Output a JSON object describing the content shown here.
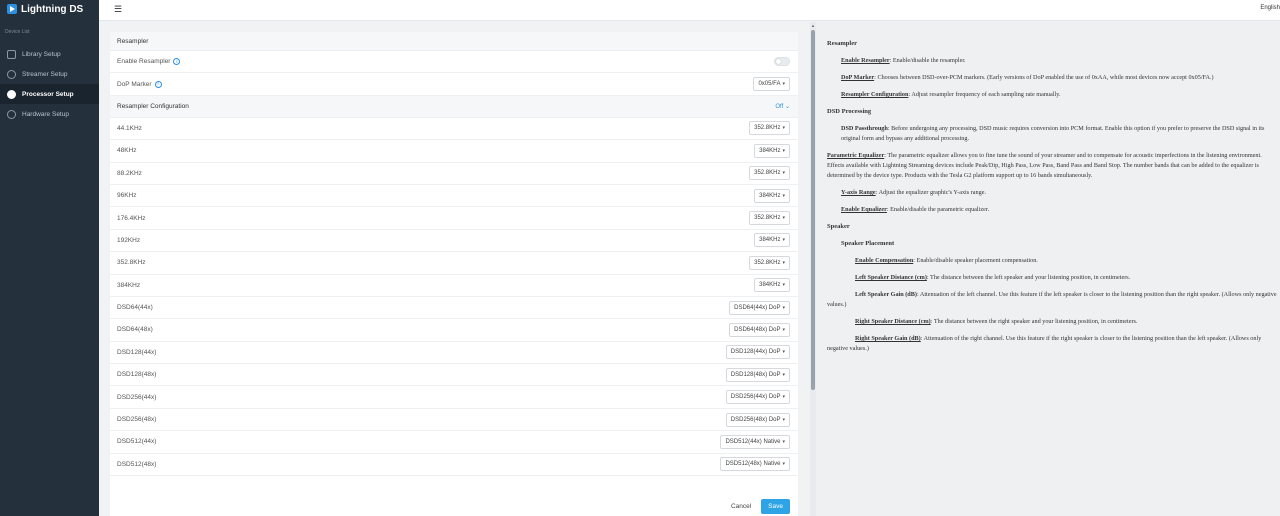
{
  "app": {
    "title": "Lightning DS",
    "device_list": "Device List",
    "language": "English"
  },
  "sidebar": {
    "items": [
      {
        "label": "Library Setup",
        "icon": "library-icon",
        "active": false
      },
      {
        "label": "Streamer Setup",
        "icon": "play-icon",
        "active": false
      },
      {
        "label": "Processor Setup",
        "icon": "processor-icon",
        "active": true
      },
      {
        "label": "Hardware Setup",
        "icon": "gear-icon",
        "active": false
      }
    ]
  },
  "resampler": {
    "section_title": "Resampler",
    "enable_label": "Enable Resampler",
    "enable_on": false,
    "dop_label": "DoP Marker",
    "dop_value": "0x05/FA",
    "config_title": "Resampler Configuration",
    "config_state": "Off",
    "rows": [
      {
        "label": "44.1KHz",
        "value": "352.8KHz"
      },
      {
        "label": "48KHz",
        "value": "384KHz"
      },
      {
        "label": "88.2KHz",
        "value": "352.8KHz"
      },
      {
        "label": "96KHz",
        "value": "384KHz"
      },
      {
        "label": "176.4KHz",
        "value": "352.8KHz"
      },
      {
        "label": "192KHz",
        "value": "384KHz"
      },
      {
        "label": "352.8KHz",
        "value": "352.8KHz"
      },
      {
        "label": "384KHz",
        "value": "384KHz"
      },
      {
        "label": "DSD64(44x)",
        "value": "DSD64(44x) DoP"
      },
      {
        "label": "DSD64(48x)",
        "value": "DSD64(48x) DoP"
      },
      {
        "label": "DSD128(44x)",
        "value": "DSD128(44x) DoP"
      },
      {
        "label": "DSD128(48x)",
        "value": "DSD128(48x) DoP"
      },
      {
        "label": "DSD256(44x)",
        "value": "DSD256(44x) DoP"
      },
      {
        "label": "DSD256(48x)",
        "value": "DSD256(48x) DoP"
      },
      {
        "label": "DSD512(44x)",
        "value": "DSD512(44x) Native"
      },
      {
        "label": "DSD512(48x)",
        "value": "DSD512(48x) Native"
      }
    ],
    "cancel_label": "Cancel",
    "save_label": "Save"
  },
  "help": {
    "resampler_title": "Resampler",
    "enable_resampler_term": "Enable Resampler",
    "enable_resampler_text": ": Enable/disable the resampler.",
    "dop_marker_term": "DoP Marker",
    "dop_marker_text": ": Chooses between DSD-over-PCM markers. (Early versions of DoP enabled the use of 0xAA, while most devices now accept 0x05/FA.)",
    "resampler_config_term": "Resampler Configuration",
    "resampler_config_text": ": Adjust resampler frequency of each sampling rate manually.",
    "dsd_processing_title": "DSD Processing",
    "dsd_passthrough_term": "DSD Passthrough",
    "dsd_passthrough_text": ": Before undergoing any processing, DSD music requires conversion into PCM format. Enable this option if you prefer to preserve the DSD signal in its original form and bypass any additional processing.",
    "peq_term": "Parametric Equalizer",
    "peq_text": ": The parametric equalizer allows you to fine tune the sound of your streamer and to compensate for acoustic imperfections in the listening environment. Effects available with Lightning Streaming devices include Peak/Dip, High Pass, Low Pass, Band Pass and Band Stop. The number bands that can be added to the equalizer is determined by the device type. Products with the Tesla G2 platform support up to 16 bands simultaneously.",
    "yaxis_term": "Y-axis Range",
    "yaxis_text": ": Adjust the equalizer graphic's Y-axis range.",
    "enable_eq_term": "Enable Equalizer",
    "enable_eq_text": ": Enable/disable the parametric equalizer.",
    "speaker_title": "Speaker",
    "speaker_placement_title": "Speaker Placement",
    "enable_comp_term": "Enable Compensation",
    "enable_comp_text": ": Enable/disable speaker placement compensation.",
    "left_dist_term": "Left Speaker Distance (cm)",
    "left_dist_text": ": The distance between the left speaker and your listening position, in centimeters.",
    "left_gain_term": "Left Speaker Gain (dB)",
    "left_gain_text": ": Attenuation of the left channel. Use this feature if the left speaker is closer to the listening position than the right speaker. (Allows only negative values.)",
    "right_dist_term": "Right Speaker Distance (cm)",
    "right_dist_text": ": The distance between the right speaker and your listening position, in centimeters.",
    "right_gain_term": "Right Speaker Gain (dB)",
    "right_gain_text": ": Attenuation of the right channel. Use this feature if the right speaker is closer to the listening position than the left speaker. (Allows only negative values.)"
  }
}
